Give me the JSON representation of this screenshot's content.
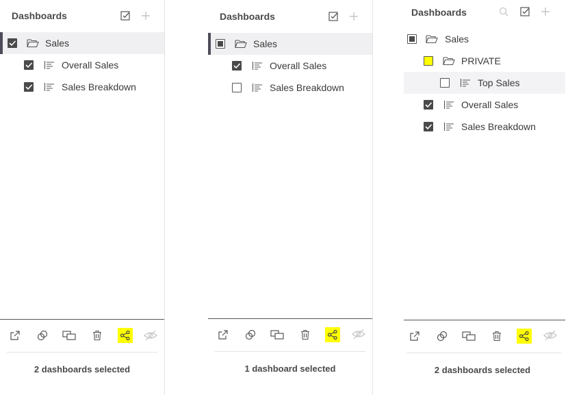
{
  "panels": [
    {
      "title": "Dashboards",
      "tree": [
        {
          "label": "Sales",
          "type": "folder",
          "state": "checked"
        },
        {
          "label": "Overall Sales",
          "type": "dashboard",
          "state": "checked"
        },
        {
          "label": "Sales Breakdown",
          "type": "dashboard",
          "state": "checked"
        }
      ],
      "status": "2 dashboards selected"
    },
    {
      "title": "Dashboards",
      "tree": [
        {
          "label": "Sales",
          "type": "folder",
          "state": "partial"
        },
        {
          "label": "Overall Sales",
          "type": "dashboard",
          "state": "checked"
        },
        {
          "label": "Sales Breakdown",
          "type": "dashboard",
          "state": "unchecked"
        }
      ],
      "status": "1 dashboard selected"
    },
    {
      "title": "Dashboards",
      "tree": [
        {
          "label": "Sales",
          "type": "folder",
          "state": "partial"
        },
        {
          "label": "PRIVATE",
          "type": "folder",
          "state": "unchecked-highlighted"
        },
        {
          "label": "Top Sales",
          "type": "dashboard",
          "state": "unchecked"
        },
        {
          "label": "Overall Sales",
          "type": "dashboard",
          "state": "checked"
        },
        {
          "label": "Sales Breakdown",
          "type": "dashboard",
          "state": "checked"
        }
      ],
      "status": "2 dashboards selected"
    }
  ],
  "icons": {
    "header": [
      "check-square-icon",
      "plus-icon",
      "search-icon"
    ],
    "footer": [
      "open-external-icon",
      "link-icon",
      "duplicate-icon",
      "trash-icon",
      "share-icon",
      "hide-icon"
    ]
  },
  "colors": {
    "highlight": "#ffff00",
    "selected_row": "#f0f0f2",
    "selected_bar": "#4d4d59",
    "text": "#3a3a3a"
  }
}
